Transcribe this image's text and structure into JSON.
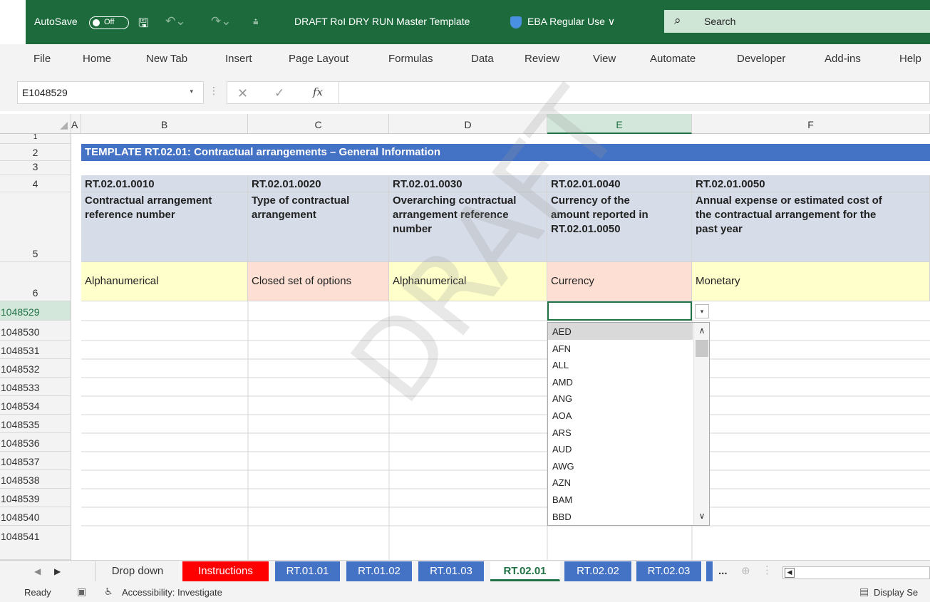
{
  "titlebar": {
    "autosave_label": "AutoSave",
    "autosave_state": "Off",
    "doc_title": "DRAFT RoI DRY RUN Master Template",
    "sensitivity": "EBA Regular Use ∨",
    "search_placeholder": "Search"
  },
  "ribbon": {
    "tabs": [
      "File",
      "Home",
      "New Tab",
      "Insert",
      "Page Layout",
      "Formulas",
      "Data",
      "Review",
      "View",
      "Automate",
      "Developer",
      "Add-ins",
      "Help"
    ]
  },
  "formula_bar": {
    "name_box": "E1048529",
    "formula": ""
  },
  "grid": {
    "columns": [
      "A",
      "B",
      "C",
      "D",
      "E",
      "F"
    ],
    "selected_column": "E",
    "rows": [
      "1",
      "2",
      "3",
      "4",
      "5",
      "6"
    ],
    "bottom_rows": [
      "1048529",
      "1048530",
      "1048531",
      "1048532",
      "1048533",
      "1048534",
      "1048535",
      "1048536",
      "1048537",
      "1048538",
      "1048539",
      "1048540",
      "1048541"
    ],
    "banner": "TEMPLATE RT.02.01: Contractual arrangements – General Information",
    "codes": [
      "RT.02.01.0010",
      "RT.02.01.0020",
      "RT.02.01.0030",
      "RT.02.01.0040",
      "RT.02.01.0050"
    ],
    "names": [
      [
        "Contractual arrangement",
        "reference number"
      ],
      [
        "Type of contractual",
        "arrangement"
      ],
      [
        "Overarching contractual",
        "arrangement reference",
        "number"
      ],
      [
        "Currency of the",
        "amount reported in",
        "RT.02.01.0050"
      ],
      [
        "Annual expense or estimated cost of",
        "the contractual arrangement for the",
        "past year"
      ]
    ],
    "types": [
      "Alphanumerical",
      "Closed set of options",
      "Alphanumerical",
      "Currency",
      "Monetary"
    ]
  },
  "dropdown": {
    "options": [
      "AED",
      "AFN",
      "ALL",
      "AMD",
      "ANG",
      "AOA",
      "ARS",
      "AUD",
      "AWG",
      "AZN",
      "BAM",
      "BBD"
    ],
    "highlighted": "AED"
  },
  "watermark": "DRAFT",
  "sheets": {
    "tabs": [
      "Drop down",
      "Instructions",
      "RT.01.01",
      "RT.01.02",
      "RT.01.03",
      "RT.02.01",
      "RT.02.02",
      "RT.02.03"
    ],
    "active": "RT.02.01",
    "more": "..."
  },
  "statusbar": {
    "ready": "Ready",
    "accessibility": "Accessibility: Investigate",
    "display": "Display Se"
  },
  "colors": {
    "excel_green": "#1d6b3c",
    "banner_blue": "#4472c4",
    "header_gray_blue": "#d6dde8",
    "yellow": "#ffffcc",
    "pink": "#fde0d3",
    "tab_red": "#ff0000"
  }
}
